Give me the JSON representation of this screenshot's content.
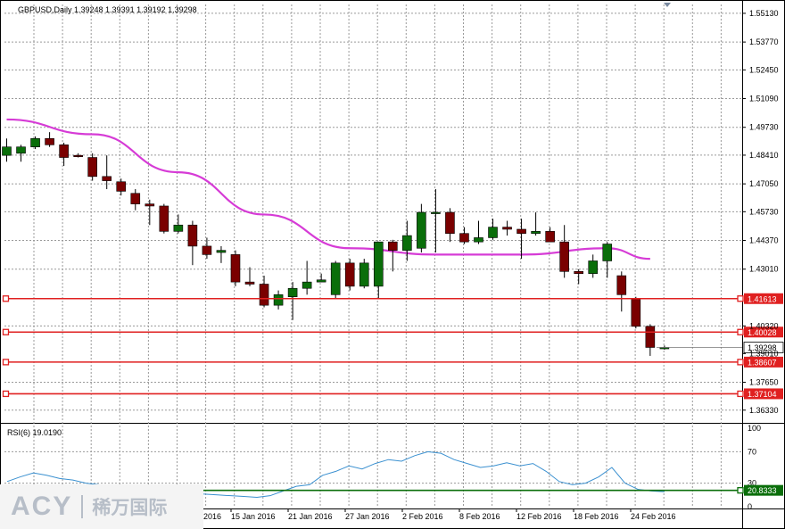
{
  "chart_data": {
    "type": "candlestick",
    "symbol_line": "GBPUSD,Daily  1.39248 1.39391 1.39192 1.39298",
    "price_axis": {
      "ylim": [
        1.3577,
        1.5555
      ],
      "ticks": [
        "1.55130",
        "1.53770",
        "1.52450",
        "1.51090",
        "1.49730",
        "1.48410",
        "1.47050",
        "1.45730",
        "1.44370",
        "1.43010",
        "1.41613",
        "1.40320",
        "1.39298",
        "1.39010",
        "1.38607",
        "1.37650",
        "1.37104",
        "1.36330"
      ]
    },
    "date_labels": [
      "15 Jan 2016",
      "21 Jan 2016",
      "27 Jan 2016",
      "2 Feb 2016",
      "8 Feb 2016",
      "12 Feb 2016",
      "18 Feb 2016",
      "24 Feb 2016"
    ],
    "date_partial_label": "2016",
    "candles": [
      {
        "o": 1.484,
        "h": 1.492,
        "l": 1.481,
        "c": 1.488
      },
      {
        "o": 1.485,
        "h": 1.489,
        "l": 1.481,
        "c": 1.488
      },
      {
        "o": 1.488,
        "h": 1.493,
        "l": 1.487,
        "c": 1.492
      },
      {
        "o": 1.492,
        "h": 1.495,
        "l": 1.488,
        "c": 1.489
      },
      {
        "o": 1.489,
        "h": 1.49,
        "l": 1.479,
        "c": 1.483
      },
      {
        "o": 1.484,
        "h": 1.485,
        "l": 1.483,
        "c": 1.4835
      },
      {
        "o": 1.483,
        "h": 1.485,
        "l": 1.472,
        "c": 1.474
      },
      {
        "o": 1.474,
        "h": 1.484,
        "l": 1.468,
        "c": 1.472
      },
      {
        "o": 1.4715,
        "h": 1.473,
        "l": 1.465,
        "c": 1.467
      },
      {
        "o": 1.466,
        "h": 1.468,
        "l": 1.458,
        "c": 1.461
      },
      {
        "o": 1.461,
        "h": 1.463,
        "l": 1.451,
        "c": 1.46
      },
      {
        "o": 1.46,
        "h": 1.461,
        "l": 1.447,
        "c": 1.448
      },
      {
        "o": 1.448,
        "h": 1.456,
        "l": 1.447,
        "c": 1.451
      },
      {
        "o": 1.451,
        "h": 1.453,
        "l": 1.432,
        "c": 1.441
      },
      {
        "o": 1.441,
        "h": 1.445,
        "l": 1.435,
        "c": 1.437
      },
      {
        "o": 1.438,
        "h": 1.441,
        "l": 1.433,
        "c": 1.439
      },
      {
        "o": 1.437,
        "h": 1.439,
        "l": 1.422,
        "c": 1.424
      },
      {
        "o": 1.424,
        "h": 1.431,
        "l": 1.422,
        "c": 1.423
      },
      {
        "o": 1.423,
        "h": 1.427,
        "l": 1.412,
        "c": 1.413
      },
      {
        "o": 1.413,
        "h": 1.42,
        "l": 1.411,
        "c": 1.418
      },
      {
        "o": 1.417,
        "h": 1.424,
        "l": 1.406,
        "c": 1.421
      },
      {
        "o": 1.421,
        "h": 1.434,
        "l": 1.418,
        "c": 1.424
      },
      {
        "o": 1.424,
        "h": 1.428,
        "l": 1.424,
        "c": 1.425
      },
      {
        "o": 1.418,
        "h": 1.434,
        "l": 1.416,
        "c": 1.433
      },
      {
        "o": 1.433,
        "h": 1.435,
        "l": 1.42,
        "c": 1.422
      },
      {
        "o": 1.422,
        "h": 1.435,
        "l": 1.421,
        "c": 1.433
      },
      {
        "o": 1.422,
        "h": 1.443,
        "l": 1.416,
        "c": 1.443
      },
      {
        "o": 1.443,
        "h": 1.444,
        "l": 1.429,
        "c": 1.439
      },
      {
        "o": 1.439,
        "h": 1.453,
        "l": 1.434,
        "c": 1.446
      },
      {
        "o": 1.44,
        "h": 1.461,
        "l": 1.438,
        "c": 1.457
      },
      {
        "o": 1.457,
        "h": 1.468,
        "l": 1.438,
        "c": 1.457
      },
      {
        "o": 1.457,
        "h": 1.459,
        "l": 1.443,
        "c": 1.447
      },
      {
        "o": 1.447,
        "h": 1.45,
        "l": 1.442,
        "c": 1.443
      },
      {
        "o": 1.443,
        "h": 1.453,
        "l": 1.442,
        "c": 1.445
      },
      {
        "o": 1.445,
        "h": 1.454,
        "l": 1.444,
        "c": 1.45
      },
      {
        "o": 1.45,
        "h": 1.453,
        "l": 1.446,
        "c": 1.449
      },
      {
        "o": 1.449,
        "h": 1.454,
        "l": 1.435,
        "c": 1.447
      },
      {
        "o": 1.447,
        "h": 1.457,
        "l": 1.446,
        "c": 1.448
      },
      {
        "o": 1.448,
        "h": 1.45,
        "l": 1.444,
        "c": 1.443
      },
      {
        "o": 1.443,
        "h": 1.451,
        "l": 1.426,
        "c": 1.429
      },
      {
        "o": 1.429,
        "h": 1.43,
        "l": 1.423,
        "c": 1.428
      },
      {
        "o": 1.428,
        "h": 1.437,
        "l": 1.426,
        "c": 1.434
      },
      {
        "o": 1.434,
        "h": 1.443,
        "l": 1.426,
        "c": 1.442
      },
      {
        "o": 1.427,
        "h": 1.429,
        "l": 1.41,
        "c": 1.418
      },
      {
        "o": 1.416,
        "h": 1.417,
        "l": 1.402,
        "c": 1.403
      },
      {
        "o": 1.403,
        "h": 1.404,
        "l": 1.389,
        "c": 1.393
      },
      {
        "o": 1.39248,
        "h": 1.39391,
        "l": 1.39192,
        "c": 1.39298
      }
    ],
    "ma_series": {
      "x": [
        0,
        6,
        12,
        18,
        24,
        30,
        36,
        42,
        45
      ],
      "y": [
        1.501,
        1.494,
        1.476,
        1.456,
        1.44,
        1.437,
        1.437,
        1.44,
        1.435
      ]
    },
    "horizontal_levels": [
      {
        "price": 1.41613,
        "label": "1.41613"
      },
      {
        "price": 1.40028,
        "label": "1.40028"
      },
      {
        "price": 1.38607,
        "label": "1.38607"
      },
      {
        "price": 1.37104,
        "label": "1.37104"
      }
    ],
    "current_price_label": "1.39298",
    "rsi": {
      "header": "RSI(6) 19.0190",
      "ticks": [
        "100",
        "70",
        "30",
        "0"
      ],
      "level": 20.8333,
      "level_label": "20.8333",
      "values": [
        32,
        38,
        43,
        40,
        36,
        34,
        30,
        28,
        27,
        25,
        24,
        22,
        20,
        18,
        17,
        16,
        15,
        14,
        13,
        12,
        14,
        20,
        26,
        28,
        40,
        45,
        52,
        48,
        55,
        60,
        58,
        65,
        70,
        68,
        60,
        55,
        50,
        52,
        56,
        52,
        55,
        45,
        32,
        28,
        30,
        38,
        50,
        30,
        22,
        20,
        19
      ]
    },
    "colors": {
      "bull": "#0a6e0a",
      "bear": "#7a0000",
      "ma": "#d63bd6",
      "level": "#e02020",
      "rsi_line": "#3a90d0",
      "rsi_level": "#0a6e0a",
      "grid": "#9a9a9a"
    }
  },
  "logo": {
    "brand": "ACY",
    "subtitle": "稀万国际"
  }
}
